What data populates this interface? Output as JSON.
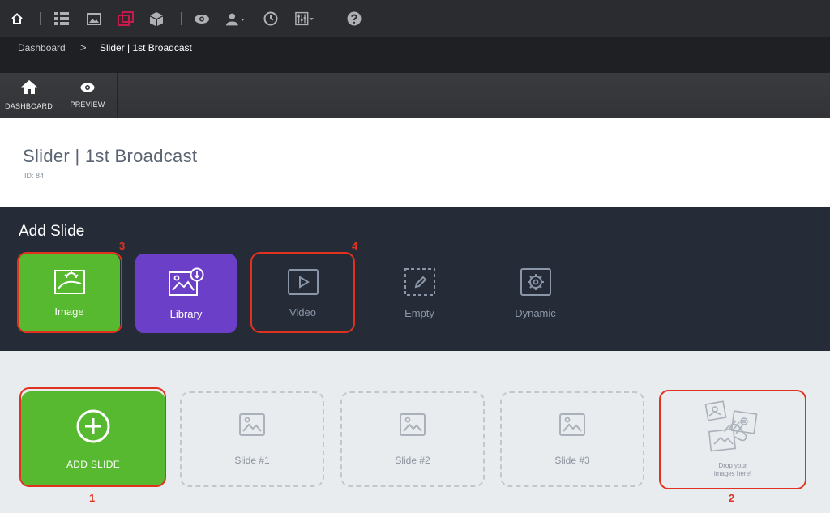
{
  "breadcrumb": {
    "home": "Dashboard",
    "current": "Slider | 1st Broadcast"
  },
  "subtoolbar": {
    "dashboard_label": "DASHBOARD",
    "preview_label": "PREVIEW"
  },
  "page": {
    "title": "Slider | 1st Broadcast",
    "id_label": "ID: 84"
  },
  "add_slide": {
    "title": "Add Slide",
    "types": [
      {
        "label": "Image",
        "icon": "image-sun-icon"
      },
      {
        "label": "Library",
        "icon": "library-icon"
      },
      {
        "label": "Video",
        "icon": "video-play-icon"
      },
      {
        "label": "Empty",
        "icon": "empty-edit-icon"
      },
      {
        "label": "Dynamic",
        "icon": "gear-icon"
      }
    ]
  },
  "slides": {
    "add_label": "ADD SLIDE",
    "items": [
      "Slide #1",
      "Slide #2",
      "Slide #3"
    ],
    "drop_line1": "Drop your",
    "drop_line2": "images here!"
  },
  "annotations": [
    "1",
    "2",
    "3",
    "4"
  ],
  "colors": {
    "accent_green": "#56b92f",
    "library_purple": "#6b3fc8",
    "highlight_red": "#e0321f",
    "panel_dark": "#252c38"
  }
}
